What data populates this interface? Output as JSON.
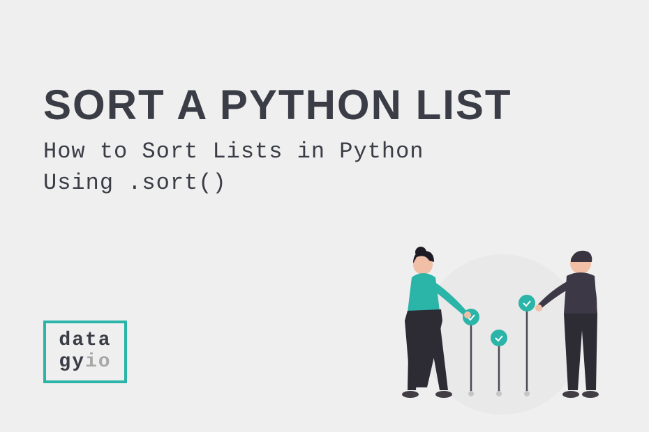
{
  "title": "SORT A PYTHON LIST",
  "subtitle": "How to Sort Lists in Python\nUsing .sort()",
  "logo": {
    "line1": "data",
    "line2a": "gy",
    "line2b": "io"
  },
  "colors": {
    "teal": "#2bb4a8",
    "dark": "#3a3c46",
    "gray": "#a8a8a8",
    "bg": "#efefef"
  }
}
